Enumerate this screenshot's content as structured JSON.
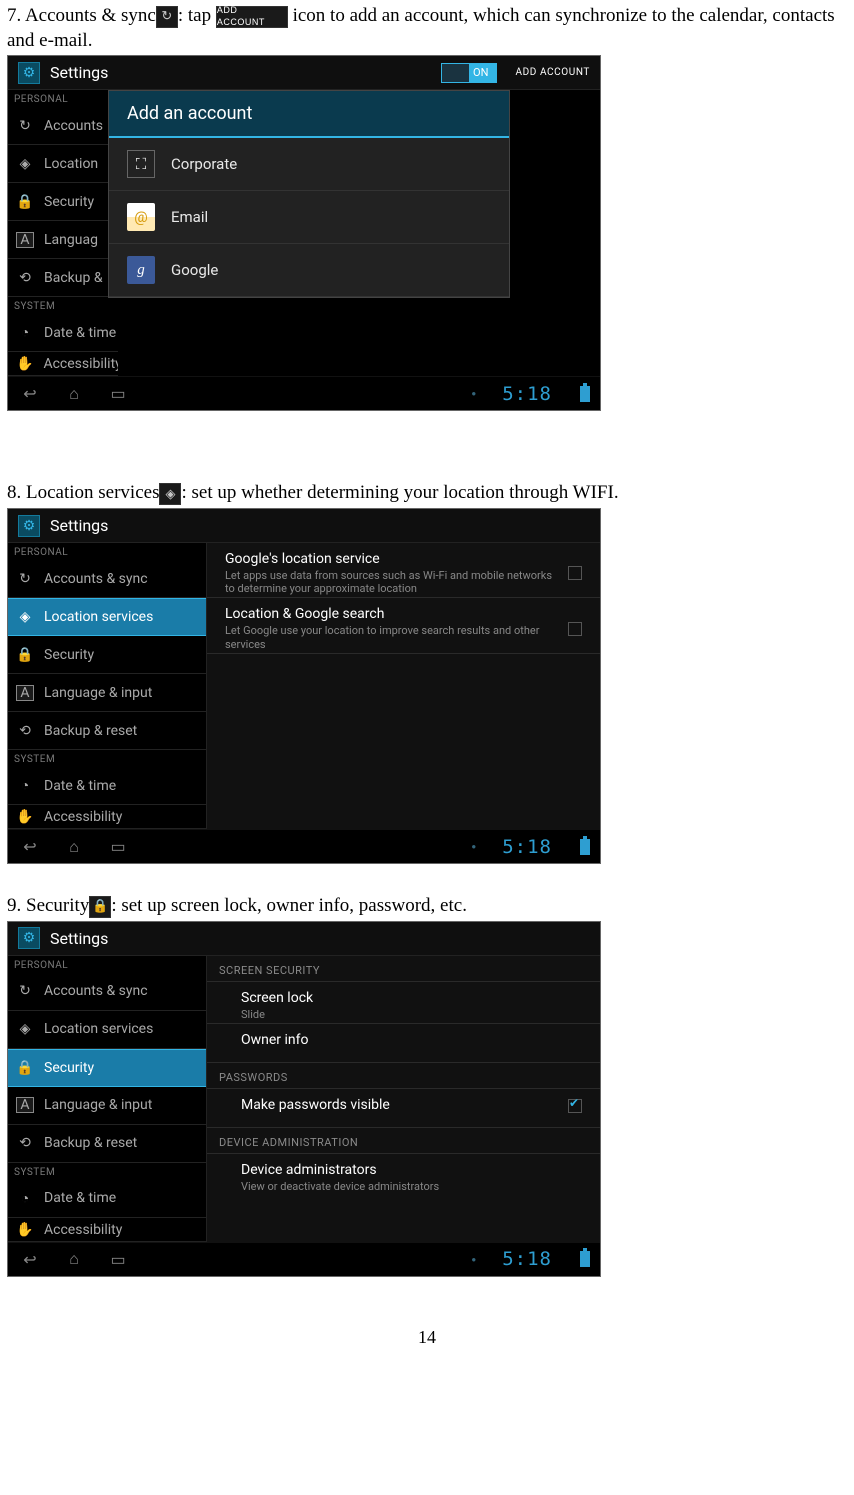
{
  "section7": {
    "prefix": "7. Accounts & sync",
    "mid": ": tap ",
    "addaccount_label": "ADD ACCOUNT",
    "suffix": "icon to add an account, which can synchronize to the calendar, contacts and e-mail."
  },
  "section8": {
    "prefix": "8. Location services",
    "suffix": ": set up whether determining your location through WIFI."
  },
  "section9": {
    "prefix": "9. Security",
    "suffix": ": set up screen lock, owner info, password, etc."
  },
  "common": {
    "settings_title": "Settings",
    "personal_lbl": "PERSONAL",
    "system_lbl": "SYSTEM",
    "clock": "5:18",
    "toggle_on": "ON",
    "addaccount_header": "ADD ACCOUNT"
  },
  "sidebar_full": {
    "accounts": "Accounts & sync",
    "location": "Location services",
    "security": "Security",
    "language": "Language & input",
    "backup": "Backup & reset",
    "datetime": "Date & time",
    "access": "Accessibility"
  },
  "sidebar_trunc": {
    "accounts": "Accounts",
    "location": "Location",
    "security": "Security",
    "language": "Languag",
    "backup": "Backup &",
    "datetime": "Date & time",
    "access": "Accessibility"
  },
  "dialog1": {
    "title": "Add an account",
    "items": [
      "Corporate",
      "Email",
      "Google"
    ]
  },
  "ss2_content": {
    "item1_title": "Google's location service",
    "item1_desc": "Let apps use data from sources such as Wi-Fi and mobile networks to determine your approximate location",
    "item2_title": "Location & Google search",
    "item2_desc": "Let Google use your location to improve search results and other services"
  },
  "ss3_content": {
    "h1": "SCREEN SECURITY",
    "screenlock": "Screen lock",
    "screenlock_sub": "Slide",
    "ownerinfo": "Owner info",
    "h2": "PASSWORDS",
    "pwvisible": "Make passwords visible",
    "h3": "DEVICE ADMINISTRATION",
    "devadmin": "Device administrators",
    "devadmin_sub": "View or deactivate device administrators"
  },
  "page_num": "14"
}
